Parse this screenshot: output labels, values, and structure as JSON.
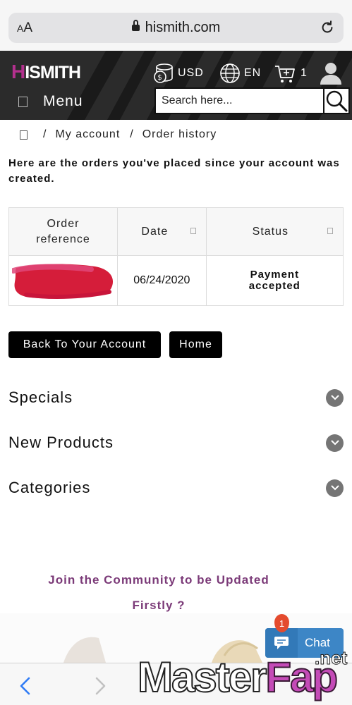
{
  "browser": {
    "text_size_label": "AA",
    "url": "hismith.com"
  },
  "header": {
    "logo_text": "HISMITH",
    "currency": "USD",
    "language": "EN",
    "cart_count": "1",
    "menu_label": "Menu",
    "search_placeholder": "Search here...",
    "accent_color": "#b3308d"
  },
  "breadcrumb": {
    "separator": "/",
    "items": [
      "My account",
      "Order history"
    ]
  },
  "intro": "Here are the orders you've placed since your account was created.",
  "orders_table": {
    "headers": [
      "Order reference",
      "Date",
      "Status"
    ],
    "rows": [
      {
        "reference": "",
        "date": "06/24/2020",
        "status": "Payment accepted"
      }
    ]
  },
  "buttons": {
    "back": "Back To Your Account",
    "home": "Home"
  },
  "sections": [
    "Specials",
    "New Products",
    "Categories"
  ],
  "join": {
    "line1": "Join the Community to be Updated",
    "line2": "Firstly ?"
  },
  "chat": {
    "label": "Chat",
    "badge": "1"
  },
  "watermark": {
    "brand_left": "Master",
    "brand_right": "Fap",
    "suffix": ".net"
  }
}
